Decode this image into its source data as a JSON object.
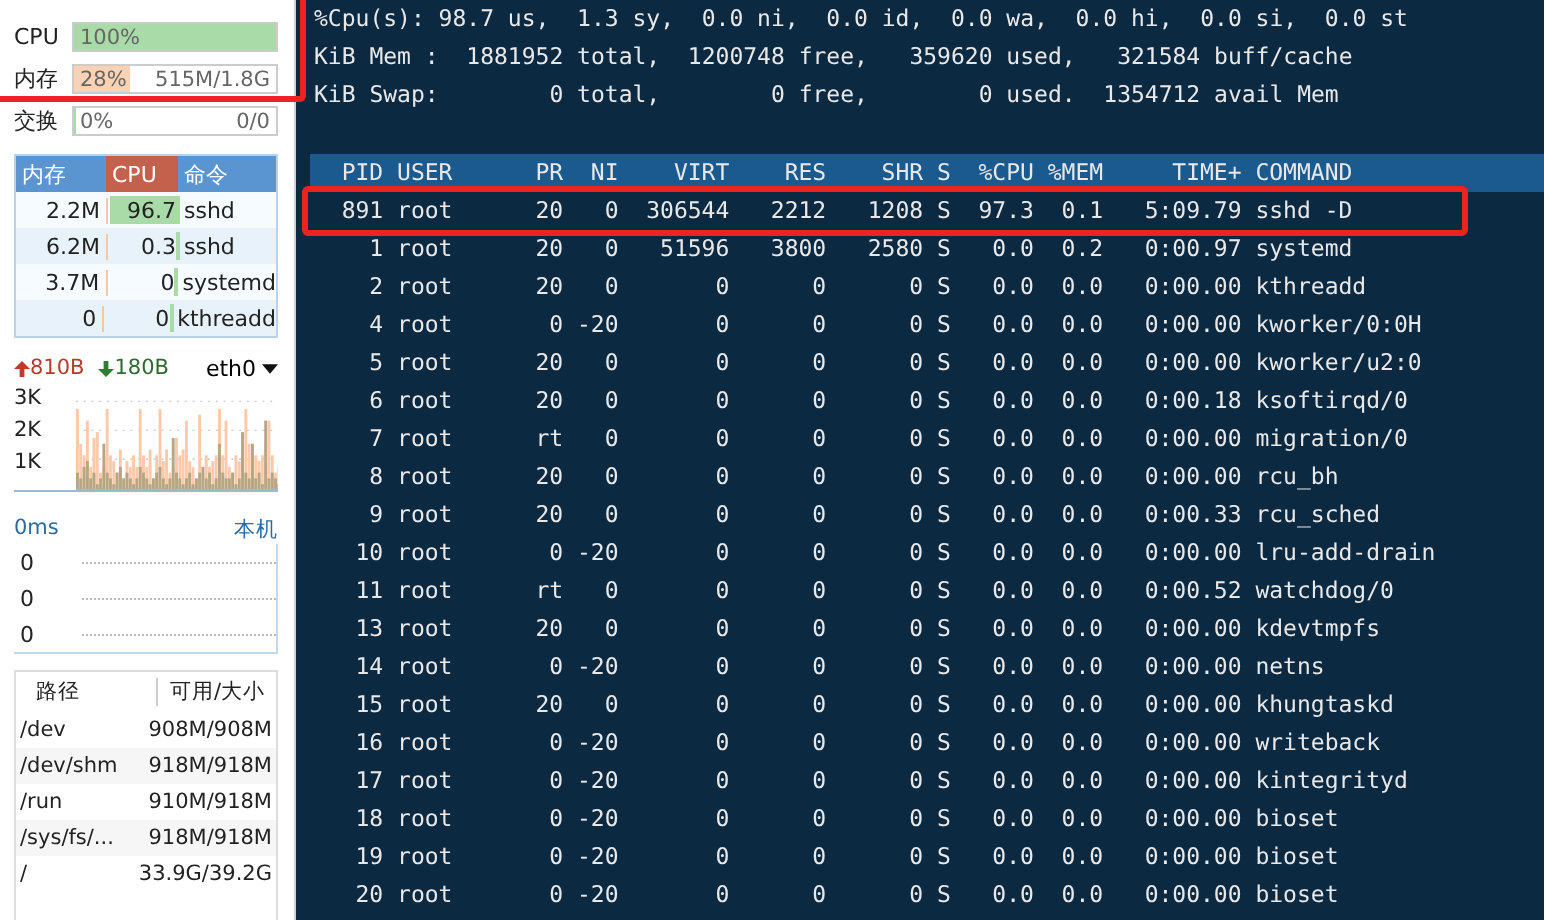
{
  "sidebar": {
    "resources": [
      {
        "label": "CPU",
        "value": "100%",
        "level": 1.0,
        "color": "#a8dba8"
      },
      {
        "label": "内存",
        "value": "28%",
        "detail": "515M/1.8G",
        "level": 0.28,
        "color": "#fbd3b4"
      },
      {
        "label": "交换",
        "value": "0%",
        "detail": "0/0",
        "level": 0,
        "color": "#a8dba8"
      }
    ],
    "processes": {
      "columns": [
        {
          "label": "内存",
          "selected": false
        },
        {
          "label": "CPU",
          "selected": true
        },
        {
          "label": "命令",
          "selected": false
        }
      ],
      "rows": [
        {
          "memory": "2.2M",
          "cpu": "96.7",
          "level": 0.967,
          "command": "sshd"
        },
        {
          "memory": "6.2M",
          "cpu": "0.3",
          "level": 0.003,
          "command": "sshd"
        },
        {
          "memory": "3.7M",
          "cpu": "0",
          "level": 0,
          "command": "systemd"
        },
        {
          "memory": "0",
          "cpu": "0",
          "level": 0,
          "command": "kthreadd"
        }
      ]
    },
    "network": {
      "upload": "810B",
      "download": "180B",
      "interface": "eth0",
      "yticks": [
        "3K",
        "2K",
        "1K"
      ]
    },
    "latency": {
      "value": "0ms",
      "host": "本机",
      "yticks": [
        "0",
        "0",
        "0"
      ]
    },
    "disks": {
      "columns": [
        "路径",
        "可用/大小"
      ],
      "rows": [
        {
          "path": "/dev",
          "usage": "908M/908M"
        },
        {
          "path": "/dev/shm",
          "usage": "918M/918M"
        },
        {
          "path": "/run",
          "usage": "910M/918M"
        },
        {
          "path": "/sys/fs/...",
          "usage": "918M/918M"
        },
        {
          "path": "/",
          "usage": "33.9G/39.2G"
        }
      ]
    }
  },
  "terminal": {
    "summary_lines": [
      "%Cpu(s): 98.7 us,  1.3 sy,  0.0 ni,  0.0 id,  0.0 wa,  0.0 hi,  0.0 si,  0.0 st",
      "KiB Mem :  1881952 total,  1200748 free,   359620 used,   321584 buff/cache",
      "KiB Swap:        0 total,        0 free,        0 used.  1354712 avail Mem"
    ],
    "columns": [
      "PID",
      "USER",
      "PR",
      "NI",
      "VIRT",
      "RES",
      "SHR",
      "S",
      "%CPU",
      "%MEM",
      "TIME+",
      "COMMAND"
    ],
    "rows": [
      [
        "891",
        "root",
        "20",
        "0",
        "306544",
        "2212",
        "1208",
        "S",
        "97.3",
        "0.1",
        "5:09.79",
        "sshd -D"
      ],
      [
        "1",
        "root",
        "20",
        "0",
        "51596",
        "3800",
        "2580",
        "S",
        "0.0",
        "0.2",
        "0:00.97",
        "systemd"
      ],
      [
        "2",
        "root",
        "20",
        "0",
        "0",
        "0",
        "0",
        "S",
        "0.0",
        "0.0",
        "0:00.00",
        "kthreadd"
      ],
      [
        "4",
        "root",
        "0",
        "-20",
        "0",
        "0",
        "0",
        "S",
        "0.0",
        "0.0",
        "0:00.00",
        "kworker/0:0H"
      ],
      [
        "5",
        "root",
        "20",
        "0",
        "0",
        "0",
        "0",
        "S",
        "0.0",
        "0.0",
        "0:00.00",
        "kworker/u2:0"
      ],
      [
        "6",
        "root",
        "20",
        "0",
        "0",
        "0",
        "0",
        "S",
        "0.0",
        "0.0",
        "0:00.18",
        "ksoftirqd/0"
      ],
      [
        "7",
        "root",
        "rt",
        "0",
        "0",
        "0",
        "0",
        "S",
        "0.0",
        "0.0",
        "0:00.00",
        "migration/0"
      ],
      [
        "8",
        "root",
        "20",
        "0",
        "0",
        "0",
        "0",
        "S",
        "0.0",
        "0.0",
        "0:00.00",
        "rcu_bh"
      ],
      [
        "9",
        "root",
        "20",
        "0",
        "0",
        "0",
        "0",
        "S",
        "0.0",
        "0.0",
        "0:00.33",
        "rcu_sched"
      ],
      [
        "10",
        "root",
        "0",
        "-20",
        "0",
        "0",
        "0",
        "S",
        "0.0",
        "0.0",
        "0:00.00",
        "lru-add-drain"
      ],
      [
        "11",
        "root",
        "rt",
        "0",
        "0",
        "0",
        "0",
        "S",
        "0.0",
        "0.0",
        "0:00.52",
        "watchdog/0"
      ],
      [
        "13",
        "root",
        "20",
        "0",
        "0",
        "0",
        "0",
        "S",
        "0.0",
        "0.0",
        "0:00.00",
        "kdevtmpfs"
      ],
      [
        "14",
        "root",
        "0",
        "-20",
        "0",
        "0",
        "0",
        "S",
        "0.0",
        "0.0",
        "0:00.00",
        "netns"
      ],
      [
        "15",
        "root",
        "20",
        "0",
        "0",
        "0",
        "0",
        "S",
        "0.0",
        "0.0",
        "0:00.00",
        "khungtaskd"
      ],
      [
        "16",
        "root",
        "0",
        "-20",
        "0",
        "0",
        "0",
        "S",
        "0.0",
        "0.0",
        "0:00.00",
        "writeback"
      ],
      [
        "17",
        "root",
        "0",
        "-20",
        "0",
        "0",
        "0",
        "S",
        "0.0",
        "0.0",
        "0:00.00",
        "kintegrityd"
      ],
      [
        "18",
        "root",
        "0",
        "-20",
        "0",
        "0",
        "0",
        "S",
        "0.0",
        "0.0",
        "0:00.00",
        "bioset"
      ],
      [
        "19",
        "root",
        "0",
        "-20",
        "0",
        "0",
        "0",
        "S",
        "0.0",
        "0.0",
        "0:00.00",
        "bioset"
      ],
      [
        "20",
        "root",
        "0",
        "-20",
        "0",
        "0",
        "0",
        "S",
        "0.0",
        "0.0",
        "0:00.00",
        "bioset"
      ]
    ]
  }
}
